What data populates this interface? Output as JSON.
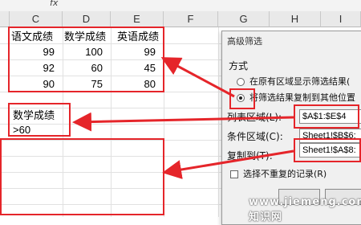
{
  "formula_bar": {
    "fx_label": "fx"
  },
  "columns": [
    "C",
    "D",
    "E",
    "F",
    "G",
    "H",
    "I"
  ],
  "table": {
    "headers": [
      "语文成绩",
      "数学成绩",
      "英语成绩"
    ],
    "rows": [
      [
        "99",
        "100",
        "99"
      ],
      [
        "92",
        "60",
        "45"
      ],
      [
        "90",
        "75",
        "80"
      ]
    ]
  },
  "criteria": {
    "header": "数学成绩",
    "value": ">60"
  },
  "dialog": {
    "title": "高级筛选",
    "method_label": "方式",
    "option_in_place": "在原有区域显示筛选结果(",
    "option_copy": "将筛选结果复制到其他位置",
    "list_range_label": "列表区域(L):",
    "list_range_value": "$A$1:$E$4",
    "criteria_range_label": "条件区域(C):",
    "criteria_range_value": "Sheet1!$B$6:",
    "copy_to_label": "复制到(T):",
    "copy_to_value": "Sheet1!$A$8:",
    "unique_label": "选择不重复的记录(R)"
  },
  "watermark": "www.jiemeng.com 知识网",
  "colors": {
    "annotation": "#e5252a",
    "header_bg": "#e9e9e9",
    "dialog_bg": "#f0f0f0"
  }
}
